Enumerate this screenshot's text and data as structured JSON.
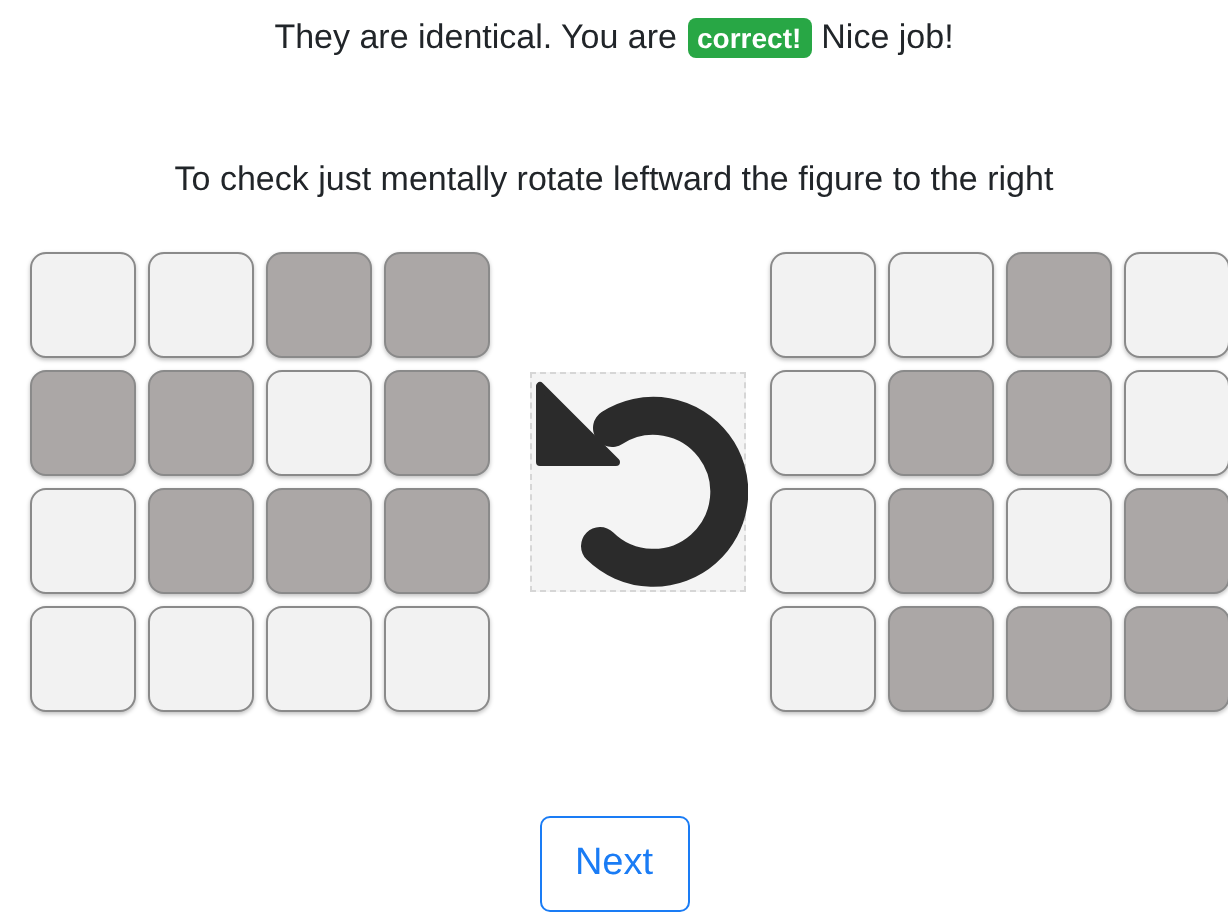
{
  "result": {
    "before": "They are identical. You are",
    "badge": "correct!",
    "after": "Nice job!"
  },
  "instruction": "To check just mentally rotate leftward the figure to the right",
  "left_grid": [
    [
      {
        "filled": false
      },
      {
        "filled": false
      },
      {
        "filled": true
      },
      {
        "filled": true
      }
    ],
    [
      {
        "filled": true
      },
      {
        "filled": true
      },
      {
        "filled": false
      },
      {
        "filled": true
      }
    ],
    [
      {
        "filled": false
      },
      {
        "filled": true
      },
      {
        "filled": true
      },
      {
        "filled": true
      }
    ],
    [
      {
        "filled": false
      },
      {
        "filled": false
      },
      {
        "filled": false
      },
      {
        "filled": false
      }
    ]
  ],
  "right_grid": [
    [
      {
        "filled": false
      },
      {
        "filled": false
      },
      {
        "filled": true
      },
      {
        "filled": false
      }
    ],
    [
      {
        "filled": false
      },
      {
        "filled": true
      },
      {
        "filled": true
      },
      {
        "filled": false
      }
    ],
    [
      {
        "filled": false
      },
      {
        "filled": true
      },
      {
        "filled": false
      },
      {
        "filled": true
      }
    ],
    [
      {
        "filled": false
      },
      {
        "filled": true
      },
      {
        "filled": true
      },
      {
        "filled": true
      }
    ]
  ],
  "buttons": [
    "Next"
  ]
}
